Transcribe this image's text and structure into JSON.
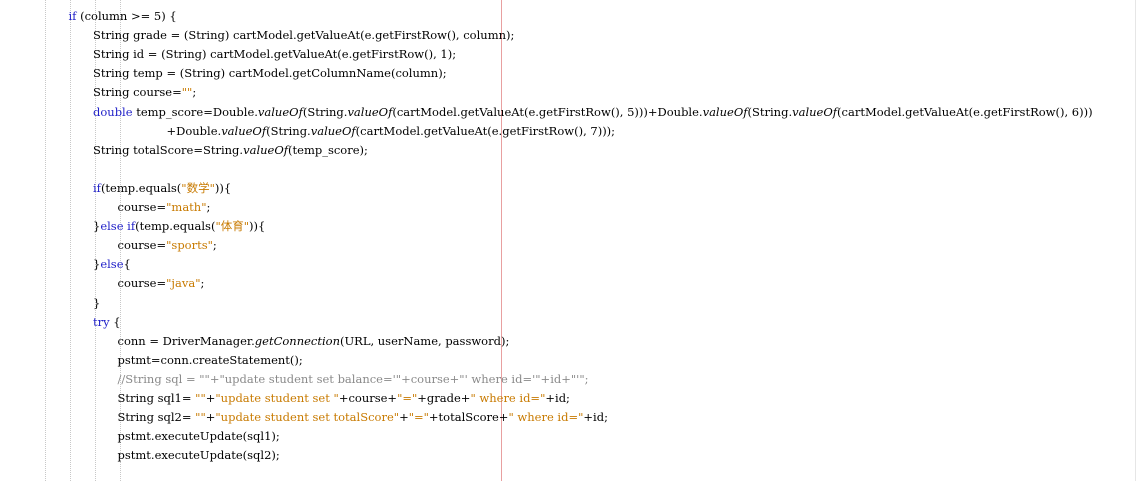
{
  "editor": {
    "colors": {
      "keyword": "#1f1fc8",
      "string": "#c87a00",
      "comment": "#8a8a8a",
      "text": "#000000",
      "edge_line": "#e8a0a0"
    },
    "lines": [
      {
        "indent": 1,
        "tokens": [
          {
            "t": "kw",
            "v": "if"
          },
          {
            "t": "n",
            "v": " (column >= 5) {"
          }
        ]
      },
      {
        "indent": 2,
        "tokens": [
          {
            "t": "n",
            "v": "String grade = (String) cartModel.getValueAt(e.getFirstRow(), column);"
          }
        ]
      },
      {
        "indent": 2,
        "tokens": [
          {
            "t": "n",
            "v": "String id = (String) cartModel.getValueAt(e.getFirstRow(), 1);"
          }
        ]
      },
      {
        "indent": 2,
        "tokens": [
          {
            "t": "n",
            "v": "String temp = (String) cartModel.getColumnName(column);"
          }
        ]
      },
      {
        "indent": 2,
        "tokens": [
          {
            "t": "n",
            "v": "String course="
          },
          {
            "t": "str",
            "v": "\"\""
          },
          {
            "t": "n",
            "v": ";"
          }
        ]
      },
      {
        "indent": 2,
        "tokens": [
          {
            "t": "kw",
            "v": "double"
          },
          {
            "t": "n",
            "v": " temp_score=Double."
          },
          {
            "t": "it",
            "v": "valueOf"
          },
          {
            "t": "n",
            "v": "(String."
          },
          {
            "t": "it",
            "v": "valueOf"
          },
          {
            "t": "n",
            "v": "(cartModel.getValueAt(e.getFirstRow(), 5)))+Double."
          },
          {
            "t": "it",
            "v": "valueOf"
          },
          {
            "t": "n",
            "v": "(String."
          },
          {
            "t": "it",
            "v": "valueOf"
          },
          {
            "t": "n",
            "v": "(cartModel.getValueAt(e.getFirstRow(), 6)))"
          }
        ]
      },
      {
        "indent": 5,
        "tokens": [
          {
            "t": "n",
            "v": "+Double."
          },
          {
            "t": "it",
            "v": "valueOf"
          },
          {
            "t": "n",
            "v": "(String."
          },
          {
            "t": "it",
            "v": "valueOf"
          },
          {
            "t": "n",
            "v": "(cartModel.getValueAt(e.getFirstRow(), 7)));"
          }
        ]
      },
      {
        "indent": 2,
        "tokens": [
          {
            "t": "n",
            "v": "String totalScore=String."
          },
          {
            "t": "it",
            "v": "valueOf"
          },
          {
            "t": "n",
            "v": "(temp_score);"
          }
        ]
      },
      {
        "indent": 2,
        "tokens": []
      },
      {
        "indent": 2,
        "tokens": [
          {
            "t": "kw",
            "v": "if"
          },
          {
            "t": "n",
            "v": "(temp.equals("
          },
          {
            "t": "str",
            "v": "\"数学\""
          },
          {
            "t": "n",
            "v": ")){"
          }
        ]
      },
      {
        "indent": 3,
        "tokens": [
          {
            "t": "n",
            "v": "course="
          },
          {
            "t": "str",
            "v": "\"math\""
          },
          {
            "t": "n",
            "v": ";"
          }
        ]
      },
      {
        "indent": 2,
        "tokens": [
          {
            "t": "n",
            "v": "}"
          },
          {
            "t": "kw",
            "v": "else if"
          },
          {
            "t": "n",
            "v": "(temp.equals("
          },
          {
            "t": "str",
            "v": "\"体育\""
          },
          {
            "t": "n",
            "v": ")){"
          }
        ]
      },
      {
        "indent": 3,
        "tokens": [
          {
            "t": "n",
            "v": "course="
          },
          {
            "t": "str",
            "v": "\"sports\""
          },
          {
            "t": "n",
            "v": ";"
          }
        ]
      },
      {
        "indent": 2,
        "tokens": [
          {
            "t": "n",
            "v": "}"
          },
          {
            "t": "kw",
            "v": "else"
          },
          {
            "t": "n",
            "v": "{"
          }
        ]
      },
      {
        "indent": 3,
        "tokens": [
          {
            "t": "n",
            "v": "course="
          },
          {
            "t": "str",
            "v": "\"java\""
          },
          {
            "t": "n",
            "v": ";"
          }
        ]
      },
      {
        "indent": 2,
        "tokens": [
          {
            "t": "n",
            "v": "}"
          }
        ]
      },
      {
        "indent": 2,
        "tokens": [
          {
            "t": "kw",
            "v": "try"
          },
          {
            "t": "n",
            "v": " {"
          }
        ]
      },
      {
        "indent": 3,
        "tokens": [
          {
            "t": "n",
            "v": "conn = DriverManager."
          },
          {
            "t": "it",
            "v": "getConnection"
          },
          {
            "t": "n",
            "v": "(URL, userName, password);"
          }
        ]
      },
      {
        "indent": 3,
        "tokens": [
          {
            "t": "n",
            "v": "pstmt=conn.createStatement();"
          }
        ]
      },
      {
        "indent": 3,
        "tokens": [
          {
            "t": "cmt",
            "v": "//String sql = \"\"+\"update student set balance='\"+course+\"' where id='\"+id+\"'\";"
          }
        ]
      },
      {
        "indent": 3,
        "tokens": [
          {
            "t": "n",
            "v": "String sql1= "
          },
          {
            "t": "str",
            "v": "\"\""
          },
          {
            "t": "n",
            "v": "+"
          },
          {
            "t": "str",
            "v": "\"update student set \""
          },
          {
            "t": "n",
            "v": "+course+"
          },
          {
            "t": "str",
            "v": "\"=\""
          },
          {
            "t": "n",
            "v": "+grade+"
          },
          {
            "t": "str",
            "v": "\" where id=\""
          },
          {
            "t": "n",
            "v": "+id;"
          }
        ]
      },
      {
        "indent": 3,
        "tokens": [
          {
            "t": "n",
            "v": "String sql2= "
          },
          {
            "t": "str",
            "v": "\"\""
          },
          {
            "t": "n",
            "v": "+"
          },
          {
            "t": "str",
            "v": "\"update student set totalScore\""
          },
          {
            "t": "n",
            "v": "+"
          },
          {
            "t": "str",
            "v": "\"=\""
          },
          {
            "t": "n",
            "v": "+totalScore+"
          },
          {
            "t": "str",
            "v": "\" where id=\""
          },
          {
            "t": "n",
            "v": "+id;"
          }
        ]
      },
      {
        "indent": 3,
        "tokens": [
          {
            "t": "n",
            "v": "pstmt.executeUpdate(sql1);"
          }
        ]
      },
      {
        "indent": 3,
        "tokens": [
          {
            "t": "n",
            "v": "pstmt.executeUpdate(sql2);"
          }
        ]
      }
    ]
  }
}
